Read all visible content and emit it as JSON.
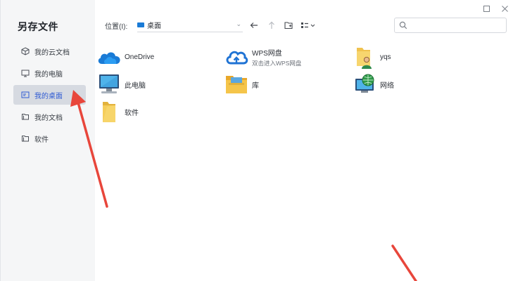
{
  "dialog": {
    "title": "另存文件"
  },
  "sidebar": {
    "items": [
      {
        "label": "我的云文档",
        "icon": "cloud-cube-icon",
        "active": false
      },
      {
        "label": "我的电脑",
        "icon": "monitor-icon",
        "active": false
      },
      {
        "label": "我的桌面",
        "icon": "desktop-icon",
        "active": true
      },
      {
        "label": "我的文档",
        "icon": "documents-icon",
        "active": false
      },
      {
        "label": "软件",
        "icon": "folder-icon",
        "active": false
      }
    ]
  },
  "toolbar": {
    "location_label": "位置(I):",
    "location_value": "桌面",
    "buttons": [
      "back-arrow-icon",
      "up-arrow-icon",
      "new-folder-icon",
      "view-mode-icon"
    ]
  },
  "search": {
    "placeholder": ""
  },
  "items": [
    {
      "name": "OneDrive",
      "sub": "",
      "icon": "onedrive-cloud-icon"
    },
    {
      "name": "WPS网盘",
      "sub": "双击进入WPS网盘",
      "icon": "wps-cloud-icon"
    },
    {
      "name": "yqs",
      "sub": "",
      "icon": "user-folder-icon"
    },
    {
      "name": "此电脑",
      "sub": "",
      "icon": "computer-icon"
    },
    {
      "name": "库",
      "sub": "",
      "icon": "library-icon"
    },
    {
      "name": "网络",
      "sub": "",
      "icon": "network-icon"
    },
    {
      "name": "软件",
      "sub": "",
      "icon": "folder-icon"
    }
  ],
  "colors": {
    "accent": "#2f5bd3",
    "annotation_arrow": "#e8463b",
    "sidebar_bg": "#f5f6f7"
  }
}
